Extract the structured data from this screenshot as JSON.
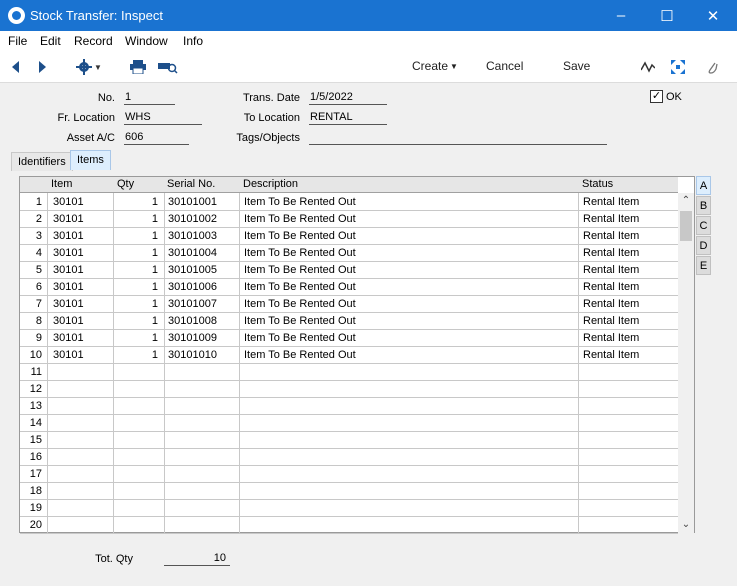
{
  "window": {
    "title": "Stock Transfer: Inspect"
  },
  "menu": [
    "File",
    "Edit",
    "Record",
    "Window",
    "Info"
  ],
  "toolbar": {
    "create": "Create",
    "cancel": "Cancel",
    "save": "Save"
  },
  "form": {
    "no_label": "No.",
    "no_value": "1",
    "fr_location_label": "Fr. Location",
    "fr_location_value": "WHS",
    "asset_label": "Asset A/C",
    "asset_value": "606",
    "trans_date_label": "Trans. Date",
    "trans_date_value": "1/5/2022",
    "to_location_label": "To Location",
    "to_location_value": "RENTAL",
    "tags_label": "Tags/Objects",
    "tags_value": "",
    "ok_label": "OK",
    "ok_checked": true
  },
  "tabs": [
    "Identifiers",
    "Items"
  ],
  "grid": {
    "columns": [
      "Item",
      "Qty",
      "Serial No.",
      "Description",
      "Status"
    ],
    "rows": [
      {
        "n": "1",
        "item": "30101",
        "qty": "1",
        "serial": "30101001",
        "desc": "Item To Be Rented Out",
        "status": "Rental Item"
      },
      {
        "n": "2",
        "item": "30101",
        "qty": "1",
        "serial": "30101002",
        "desc": "Item To Be Rented Out",
        "status": "Rental Item"
      },
      {
        "n": "3",
        "item": "30101",
        "qty": "1",
        "serial": "30101003",
        "desc": "Item To Be Rented Out",
        "status": "Rental Item"
      },
      {
        "n": "4",
        "item": "30101",
        "qty": "1",
        "serial": "30101004",
        "desc": "Item To Be Rented Out",
        "status": "Rental Item"
      },
      {
        "n": "5",
        "item": "30101",
        "qty": "1",
        "serial": "30101005",
        "desc": "Item To Be Rented Out",
        "status": "Rental Item"
      },
      {
        "n": "6",
        "item": "30101",
        "qty": "1",
        "serial": "30101006",
        "desc": "Item To Be Rented Out",
        "status": "Rental Item"
      },
      {
        "n": "7",
        "item": "30101",
        "qty": "1",
        "serial": "30101007",
        "desc": "Item To Be Rented Out",
        "status": "Rental Item"
      },
      {
        "n": "8",
        "item": "30101",
        "qty": "1",
        "serial": "30101008",
        "desc": "Item To Be Rented Out",
        "status": "Rental Item"
      },
      {
        "n": "9",
        "item": "30101",
        "qty": "1",
        "serial": "30101009",
        "desc": "Item To Be Rented Out",
        "status": "Rental Item"
      },
      {
        "n": "10",
        "item": "30101",
        "qty": "1",
        "serial": "30101010",
        "desc": "Item To Be Rented Out",
        "status": "Rental Item"
      },
      {
        "n": "11",
        "item": "",
        "qty": "",
        "serial": "",
        "desc": "",
        "status": ""
      },
      {
        "n": "12",
        "item": "",
        "qty": "",
        "serial": "",
        "desc": "",
        "status": ""
      },
      {
        "n": "13",
        "item": "",
        "qty": "",
        "serial": "",
        "desc": "",
        "status": ""
      },
      {
        "n": "14",
        "item": "",
        "qty": "",
        "serial": "",
        "desc": "",
        "status": ""
      },
      {
        "n": "15",
        "item": "",
        "qty": "",
        "serial": "",
        "desc": "",
        "status": ""
      },
      {
        "n": "16",
        "item": "",
        "qty": "",
        "serial": "",
        "desc": "",
        "status": ""
      },
      {
        "n": "17",
        "item": "",
        "qty": "",
        "serial": "",
        "desc": "",
        "status": ""
      },
      {
        "n": "18",
        "item": "",
        "qty": "",
        "serial": "",
        "desc": "",
        "status": ""
      },
      {
        "n": "19",
        "item": "",
        "qty": "",
        "serial": "",
        "desc": "",
        "status": ""
      },
      {
        "n": "20",
        "item": "",
        "qty": "",
        "serial": "",
        "desc": "",
        "status": ""
      }
    ]
  },
  "side_tabs": [
    "A",
    "B",
    "C",
    "D",
    "E"
  ],
  "footer": {
    "tot_qty_label": "Tot. Qty",
    "tot_qty_value": "10"
  },
  "icons": [
    "app-icon",
    "minimize-icon",
    "maximize-icon",
    "close-icon",
    "back-arrow-icon",
    "forward-arrow-icon",
    "gear-icon",
    "print-icon",
    "print-preview-icon",
    "chevron-down-icon",
    "activity-icon",
    "expand-icon",
    "paperclip-icon",
    "check-icon",
    "scroll-up-icon",
    "scroll-down-icon"
  ],
  "colors": {
    "titlebar": "#1a73d1",
    "active_tab": "#ddeefd"
  }
}
